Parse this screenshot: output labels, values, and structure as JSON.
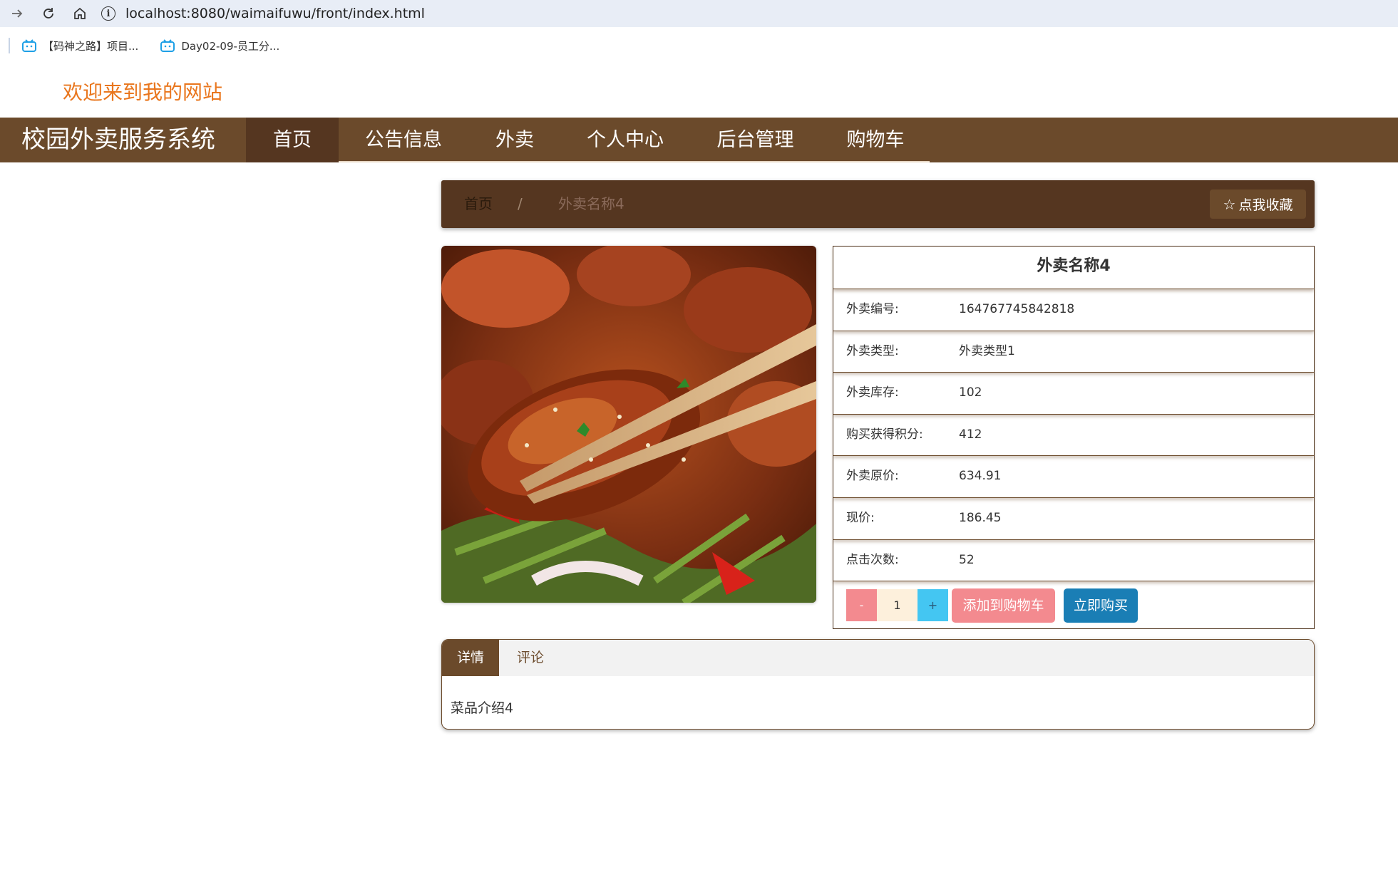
{
  "browser": {
    "url": "localhost:8080/waimaifuwu/front/index.html",
    "bookmarks": [
      {
        "label": "【码神之路】项目...",
        "icon": "bilibili-icon"
      },
      {
        "label": "Day02-09-员工分...",
        "icon": "bilibili-icon"
      }
    ]
  },
  "site": {
    "welcome": "欢迎来到我的网站",
    "brand": "校园外卖服务系统",
    "nav": [
      {
        "label": "首页",
        "active": true
      },
      {
        "label": "公告信息"
      },
      {
        "label": "外卖"
      },
      {
        "label": "个人中心"
      },
      {
        "label": "后台管理"
      },
      {
        "label": "购物车"
      }
    ]
  },
  "breadcrumb": {
    "home": "首页",
    "separator": "/",
    "current": "外卖名称4",
    "favorite_label": "点我收藏",
    "favorite_icon": "star-outline-icon"
  },
  "product": {
    "image_alt": "food-photo",
    "title": "外卖名称4",
    "rows": [
      {
        "label": "外卖编号:",
        "value": "164767745842818"
      },
      {
        "label": "外卖类型:",
        "value": "外卖类型1"
      },
      {
        "label": "外卖库存:",
        "value": "102"
      },
      {
        "label": "购买获得积分:",
        "value": "412"
      },
      {
        "label": "外卖原价:",
        "value": "634.91"
      },
      {
        "label": "现价:",
        "value": "186.45"
      },
      {
        "label": "点击次数:",
        "value": "52"
      }
    ],
    "quantity": "1",
    "minus_label": "-",
    "plus_label": "+",
    "add_cart_label": "添加到购物车",
    "buy_now_label": "立即购买"
  },
  "tabs": {
    "items": [
      {
        "label": "详情",
        "active": true
      },
      {
        "label": "评论"
      }
    ],
    "content": "菜品介绍4"
  },
  "colors": {
    "nav_bg": "#6b4a2b",
    "nav_active": "#553620",
    "welcome": "#e9761d",
    "add_cart": "#f38a8f",
    "buy_now": "#1a7eb5"
  }
}
